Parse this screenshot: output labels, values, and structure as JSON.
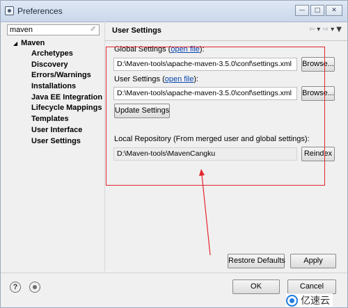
{
  "window": {
    "title": "Preferences",
    "controls": [
      "minimize",
      "maximize",
      "close"
    ]
  },
  "filter": {
    "value": "maven"
  },
  "tree": {
    "root": "Maven",
    "items": [
      "Archetypes",
      "Discovery",
      "Errors/Warnings",
      "Installations",
      "Java EE Integration",
      "Lifecycle Mappings",
      "Templates",
      "User Interface",
      "User Settings"
    ],
    "selected": "User Settings"
  },
  "page": {
    "title": "User Settings",
    "global_settings_label": "Global Settings (",
    "open_file_link": "open file",
    "label_close": "):",
    "global_settings_value": "D:\\Maven-tools\\apache-maven-3.5.0\\conf\\settings.xml",
    "user_settings_label": "User Settings (",
    "user_settings_value": "D:\\Maven-tools\\apache-maven-3.5.0\\conf\\settings.xml",
    "browse_label": "Browse...",
    "update_settings_label": "Update Settings",
    "local_repo_label": "Local Repository (From merged user and global settings):",
    "local_repo_value": "D:\\Maven-tools\\MavenCangku",
    "reindex_label": "Reindex",
    "restore_defaults_label": "Restore Defaults",
    "apply_label": "Apply"
  },
  "footer": {
    "ok_label": "OK",
    "cancel_label": "Cancel"
  },
  "watermark": {
    "text": "亿速云"
  },
  "annotation_color": "#e4252c"
}
